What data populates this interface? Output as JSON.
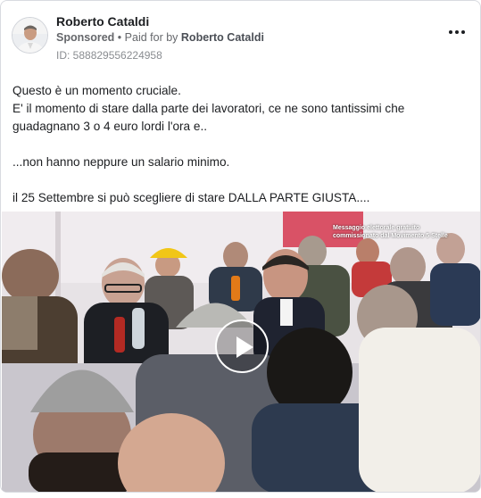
{
  "advertiser": {
    "name": "Roberto Cataldi",
    "sponsored_label": "Sponsored",
    "separator": "•",
    "paid_for_prefix": "Paid for by",
    "paid_for_name": "Roberto Cataldi",
    "id_text": "ID: 588829556224958"
  },
  "more_icon": "ellipsis-horizontal-icon",
  "post": {
    "lines": [
      "Questo è un momento cruciale.",
      "E' il momento di stare dalla parte dei lavoratori, ce ne sono tantissimi che guadagnano 3 o 4 euro lordi l'ora e..",
      "...non hanno neppure un salario minimo.",
      "il 25 Settembre si può scegliere di stare DALLA PARTE GIUSTA...."
    ]
  },
  "media": {
    "caption": "Messaggio elettorale gratuito commissionato dal Movimento 5 Stelle",
    "play_icon": "play-icon"
  },
  "colors": {
    "text": "#1c1e21",
    "secondary": "#65676b",
    "border": "#d9dbe0"
  }
}
